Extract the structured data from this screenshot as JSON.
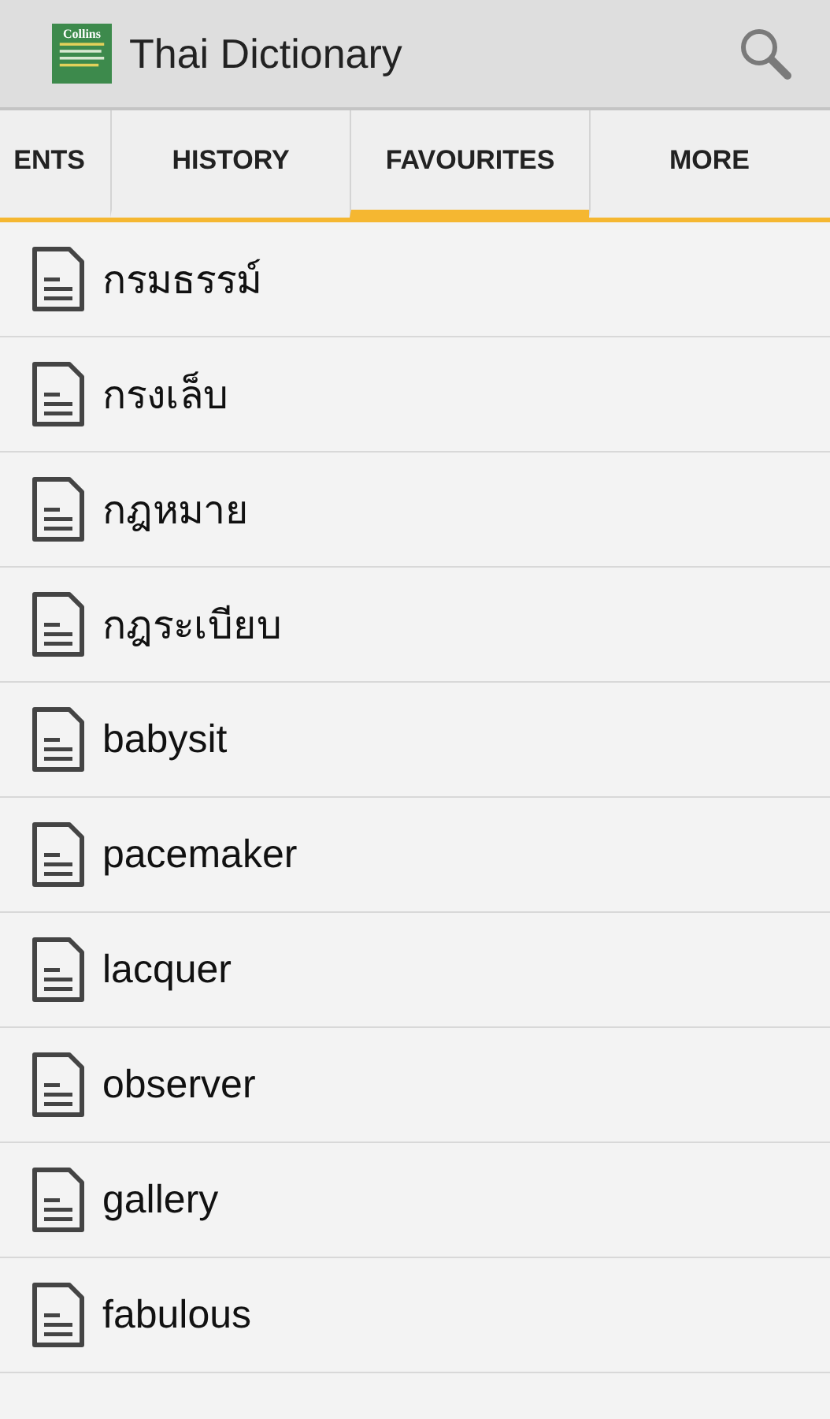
{
  "app_bar": {
    "logo_text": "Collins",
    "title": "Thai Dictionary"
  },
  "tabs": [
    {
      "label": "ENTS",
      "selected": false
    },
    {
      "label": "HISTORY",
      "selected": false
    },
    {
      "label": "FAVOURITES",
      "selected": true
    },
    {
      "label": "MORE",
      "selected": false
    }
  ],
  "favourites": [
    "กรมธรรม์",
    "กรงเล็บ",
    "กฎหมาย",
    "กฎระเบียบ",
    "babysit",
    "pacemaker",
    "lacquer",
    "observer",
    "gallery",
    "fabulous"
  ]
}
